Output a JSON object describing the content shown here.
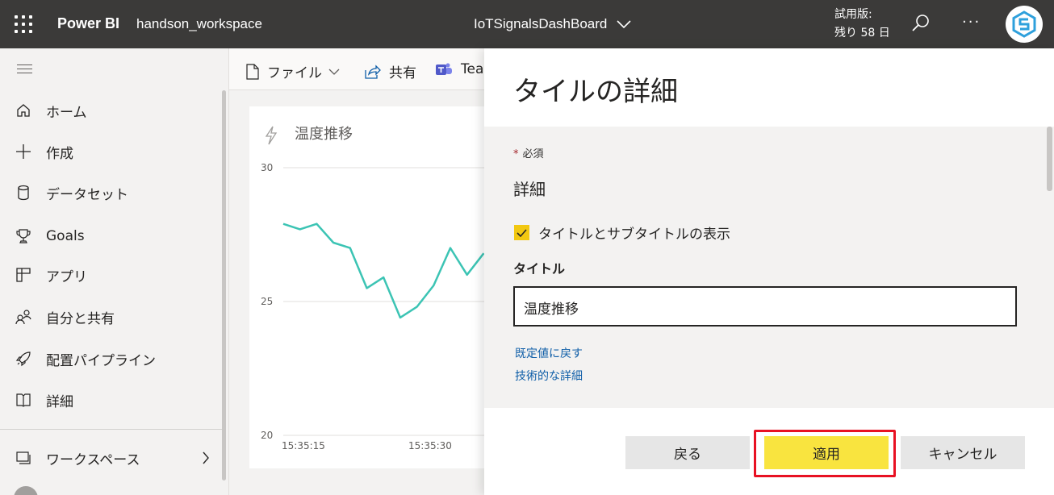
{
  "topbar": {
    "brand": "Power BI",
    "workspace": "handson_workspace",
    "dashboard": "IoTSignalsDashBoard",
    "trial_line1": "試用版:",
    "trial_line2": "残り 58 日",
    "more": "···"
  },
  "nav": {
    "items": [
      {
        "label": "ホーム",
        "icon": "home-icon"
      },
      {
        "label": "作成",
        "icon": "plus-icon"
      },
      {
        "label": "データセット",
        "icon": "database-icon"
      },
      {
        "label": "Goals",
        "icon": "trophy-icon"
      },
      {
        "label": "アプリ",
        "icon": "apps-icon"
      },
      {
        "label": "自分と共有",
        "icon": "people-icon"
      },
      {
        "label": "配置パイプライン",
        "icon": "rocket-icon"
      },
      {
        "label": "詳細",
        "icon": "book-icon"
      }
    ],
    "workspaces": "ワークスペース"
  },
  "actions": {
    "file": "ファイル",
    "share": "共有",
    "teams": "Tea"
  },
  "tile": {
    "title": "温度推移",
    "chart_data": {
      "type": "line",
      "x_ticks": [
        "15:35:15",
        "15:35:30"
      ],
      "y_ticks": [
        "30",
        "25",
        "20"
      ],
      "ylim": [
        20,
        30
      ],
      "series": [
        {
          "color": "#3cc4b4",
          "values": [
            27.9,
            27.7,
            27.9,
            27.2,
            27.0,
            25.5,
            25.9,
            24.4,
            24.8,
            25.6,
            27.0,
            26.0,
            26.8
          ]
        }
      ]
    }
  },
  "panel": {
    "title": "タイルの詳細",
    "required": "必須",
    "section": "詳細",
    "checkbox_label": "タイトルとサブタイトルの表示",
    "title_label": "タイトル",
    "title_value": "温度推移",
    "link_reset": "既定値に戻す",
    "link_tech": "技術的な詳細",
    "btn_back": "戻る",
    "btn_apply": "適用",
    "btn_cancel": "キャンセル"
  }
}
